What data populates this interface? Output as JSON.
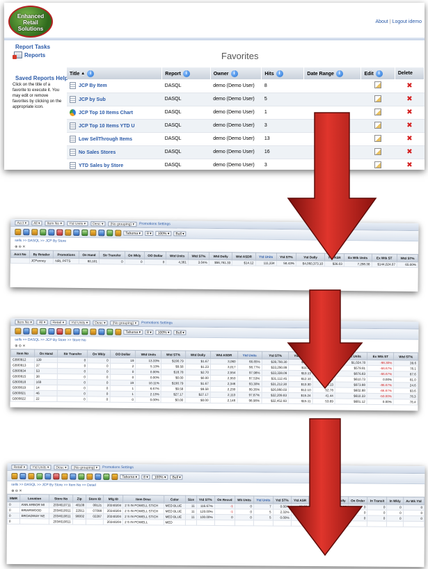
{
  "header": {
    "logo_lines": [
      "Enhanced",
      "Retail",
      "Solutions"
    ],
    "about_link": "About",
    "logout_link": "Logout idemo"
  },
  "sidebar": {
    "report_tasks_title": "Report Tasks",
    "reports_link": "Reports",
    "saved_help_title": "Saved Reports Help",
    "saved_help_text": "Click on the title of a favorite to execute it. You may edit or remove favorites by clicking on the appropriate icon."
  },
  "favorites": {
    "title": "Favorites",
    "columns": [
      "Title",
      "Report",
      "Owner",
      "Hits",
      "Date Range",
      "Edit",
      "Delete"
    ],
    "rows": [
      {
        "title": "JCP By Item",
        "report": "DASQL",
        "owner": "demo (Demo User)",
        "hits": "8",
        "icon": "table-icon"
      },
      {
        "title": "JCP by Sub",
        "report": "DASQL",
        "owner": "demo (Demo User)",
        "hits": "5",
        "icon": "table-icon"
      },
      {
        "title": "JCP Top 10 Items Chart",
        "report": "DASQL",
        "owner": "demo (Demo User)",
        "hits": "1",
        "icon": "chart-icon"
      },
      {
        "title": "JCP Top 10 Items YTD U",
        "report": "DASQL",
        "owner": "demo (Demo User)",
        "hits": "3",
        "icon": "table-icon"
      },
      {
        "title": "Low SellThrough Items",
        "report": "DASQL",
        "owner": "demo (Demo User)",
        "hits": "13",
        "icon": "table-icon"
      },
      {
        "title": "No Sales Stores",
        "report": "DASQL",
        "owner": "demo (Demo User)",
        "hits": "16",
        "icon": "table-icon"
      },
      {
        "title": "YTD Sales by Store",
        "report": "DASQL",
        "owner": "demo (Demo User)",
        "hits": "3",
        "icon": "table-icon"
      }
    ]
  },
  "screen1": {
    "toolbar_values": [
      "Acct",
      "All",
      "Item No",
      "Ytd Units",
      "Desc",
      "(No grouping)"
    ],
    "promo_link": "Promotions Settings",
    "font_select": "Tahoma",
    "size_select": "8",
    "zoom_select": "100%",
    "style_select": "Bull",
    "crumb": "sells >> DASQL >> JCP By Store",
    "columns": [
      "Acct No",
      "By Retailer",
      "Promotions",
      "On Hand",
      "Str Transfer",
      "On Wkly",
      "OO Dollar",
      "Wtd Units",
      "Wtd ST%",
      "Wtd Dolly",
      "Wtd ASDR",
      "Ytd Units",
      "Ytd ST%",
      "Ytd Dolly",
      "Ytd ASR",
      "Ex Wtk Units",
      "Ex Wtk ST",
      "Wtd ST%"
    ],
    "rows": [
      [
        "",
        "JCPenney",
        "NRL PFTS",
        "80,101",
        "0",
        "0",
        "0",
        "4,361",
        "3.04%",
        "$56,761.33",
        "$14.12",
        "111,334",
        "58.43%",
        "$4,060,373.10",
        "$36.03",
        "7,298.38",
        "$144,024.07",
        "65.00%"
      ]
    ]
  },
  "screen2": {
    "toolbar_values": [
      "Item No",
      "All",
      "Retail",
      "Ytd Units",
      "Desc",
      "(No grouping)"
    ],
    "promo_link": "Promotions Settings",
    "font_select": "Tahoma",
    "size_select": "8",
    "zoom_select": "100%",
    "style_select": "Bull",
    "crumb": "sells >> DASQL >> JCP By Store >> Store No",
    "columns": [
      "Item No",
      "On Hand",
      "Str Transfer",
      "On Wkly",
      "OO Dollar",
      "Wtd Units",
      "Wtd ST%",
      "Wtd Dolly",
      "Wtd ASDR",
      "Ytd Units",
      "Ytd ST%",
      "Ytd Dolly",
      "Ytd ASR",
      "Ex Wtk Units",
      "Ex Wtk ST",
      "Wtd ST%"
    ],
    "rows": [
      [
        "GB00812",
        "139",
        "0",
        "0",
        "19",
        "13.33%",
        "$190.79",
        "$1.67",
        "3,060",
        "68.85%",
        "$39,790.30",
        "$13.00",
        "80.67",
        "$1,024.70",
        "-98.30%",
        "39.6"
      ],
      [
        "GB00813",
        "37",
        "0",
        "0",
        "2",
        "5.13%",
        "$9.58",
        "$1.23",
        "3,017",
        "98.77%",
        "$33,290.89",
        "$11.33",
        "54.11",
        "$579.81",
        "-66.67%",
        "78.1"
      ],
      [
        "GB00834",
        "53",
        "0",
        "0",
        "0",
        "0.00%",
        "$18.78",
        "$2.70",
        "2,554",
        "97.98%",
        "$33,338.09",
        "$13.13",
        "69.55",
        "$876.83",
        "-66.67%",
        "87.6"
      ],
      [
        "GB00815",
        "38",
        "0",
        "0",
        "0",
        "0.00%",
        "$0.00",
        "$0.00",
        "2,553",
        "97.53%",
        "$31,112.45",
        "$12.10",
        "69.22",
        "$610.73",
        "0.00%",
        "81.0"
      ],
      [
        "GB00818",
        "169",
        "0",
        "0",
        "19",
        "10.11%",
        "$190.79",
        "$1.67",
        "2,346",
        "93.30%",
        "$31,212.30",
        "$13.30",
        "50.13",
        "$973.98",
        "-86.67%",
        "24.6"
      ],
      [
        "GB00819",
        "14",
        "0",
        "0",
        "1",
        "6.67%",
        "$9.58",
        "$9.58",
        "2,230",
        "99.35%",
        "$26,980.03",
        "$12.10",
        "52.78",
        "$602.88",
        "-66.67%",
        "93.6"
      ],
      [
        "GB00821",
        "46",
        "0",
        "0",
        "1",
        "2.13%",
        "$27.17",
        "$27.17",
        "2,113",
        "97.87%",
        "$32,209.83",
        "$15.24",
        "41.44",
        "$610.33",
        "-50.00%",
        "78.3"
      ],
      [
        "GB00822",
        "22",
        "0",
        "0",
        "0",
        "0.00%",
        "$0.00",
        "$0.00",
        "2,148",
        "98.98%",
        "$32,452.93",
        "$15.11",
        "53.89",
        "$681.12",
        "0.00%",
        "78.4"
      ]
    ]
  },
  "screen3": {
    "toolbar_values": [
      "Retail",
      "Ytd Units",
      "Desc",
      "(No grouping)"
    ],
    "promo_link": "Promotions Settings",
    "font_select": "Tahoma",
    "size_select": "8",
    "zoom_select": "100%",
    "style_select": "Bull",
    "crumb": "sells >> DASQL >> JCP By Store >> Item No >> Detail",
    "columns": [
      "MMR",
      "Location",
      "Store No",
      "Zip",
      "Store ID",
      "Mfg ID",
      "Item Desc",
      "Color",
      "Size",
      "Ytd ST%",
      "On Recvd",
      "Wk Units",
      "Ytd Units",
      "Ytd ST%",
      "Ytd ASR",
      "Wtd Units",
      "Ytd Dolly",
      "On Order",
      "In Transit",
      "In Wkly",
      "Av Wk Ytd"
    ],
    "rows": [
      [
        "0",
        "ANN ARBOR MI",
        "2034610711",
        "48108",
        "08121",
        "20240204",
        "2 S IN POWELL STICH",
        "MED BLUE",
        "11",
        "116.67%",
        "-1",
        "0",
        "7",
        "0.00%",
        "$0.00",
        "0",
        "$15.66",
        "0",
        "0",
        "0",
        "0"
      ],
      [
        "0",
        "BRIARWOOD",
        "2034610911",
        "22911",
        "07098",
        "20240204",
        "2 S IN POWELL STICH",
        "MED BLUE",
        "11",
        "120.00%",
        "-1",
        "0",
        "5",
        "2.32%",
        "$0.00",
        "0",
        "$17.93",
        "0",
        "0",
        "0",
        "0"
      ],
      [
        "0",
        "BROADWAY NE",
        "2034610811",
        "98002",
        "02287",
        "20240204",
        "2 S IN POWELL STICH",
        "MED BLUE",
        "11",
        "100.00%",
        "0",
        "0",
        "5",
        "0.00%",
        "$0.00",
        "0",
        "$14.99",
        "0",
        "0",
        "0",
        "0"
      ],
      [
        "0",
        "",
        "2034610811",
        "",
        "",
        "20240204",
        "2 S IN POWELL",
        "MED",
        "",
        "",
        "",
        "",
        "",
        "",
        "",
        "",
        "",
        "",
        "",
        "",
        ""
      ]
    ]
  },
  "colors": {
    "link": "#2a5aa8",
    "arrow": "#c8231e",
    "negative": "#d11b1b"
  }
}
